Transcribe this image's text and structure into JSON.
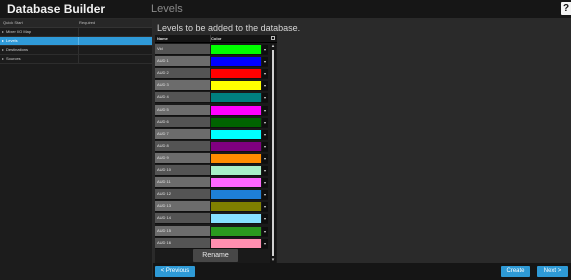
{
  "header": {
    "app_title": "Database Builder",
    "section_title": "Levels",
    "help_label": "?"
  },
  "sidebar": {
    "columns": {
      "step": "Quick Start",
      "required": "Required"
    },
    "items": [
      {
        "label": "Mixer I/O Map",
        "active": false
      },
      {
        "label": "Levels",
        "active": true
      },
      {
        "label": "Destinations",
        "active": false
      },
      {
        "label": "Sources",
        "active": false
      }
    ]
  },
  "main": {
    "heading": "Levels to be added to the database.",
    "table": {
      "columns": {
        "name": "Name",
        "color": "Color"
      },
      "rows": [
        {
          "name": "Vid",
          "color": "#00ff00"
        },
        {
          "name": "AUD 1",
          "color": "#0000ff"
        },
        {
          "name": "AUD 2",
          "color": "#ff0000"
        },
        {
          "name": "AUD 3",
          "color": "#ffff00"
        },
        {
          "name": "AUD 4",
          "color": "#008080"
        },
        {
          "name": "AUD 5",
          "color": "#ff00ff"
        },
        {
          "name": "AUD 6",
          "color": "#006400"
        },
        {
          "name": "AUD 7",
          "color": "#00ffff"
        },
        {
          "name": "AUD 8",
          "color": "#800080"
        },
        {
          "name": "AUD 9",
          "color": "#ff8c00"
        },
        {
          "name": "AUD 10",
          "color": "#a8f0c8"
        },
        {
          "name": "AUD 11",
          "color": "#ff66ff"
        },
        {
          "name": "AUD 12",
          "color": "#1e7fd6"
        },
        {
          "name": "AUD 13",
          "color": "#808000"
        },
        {
          "name": "AUD 14",
          "color": "#87e1ff"
        },
        {
          "name": "AUD 15",
          "color": "#2a9a1e"
        },
        {
          "name": "AUD 16",
          "color": "#ff8fb0"
        }
      ],
      "dropdown_glyph": "▾"
    },
    "rename_label": "Rename"
  },
  "footer": {
    "previous_label": "< Previous",
    "create_label": "Create",
    "next_label": "Next >"
  }
}
